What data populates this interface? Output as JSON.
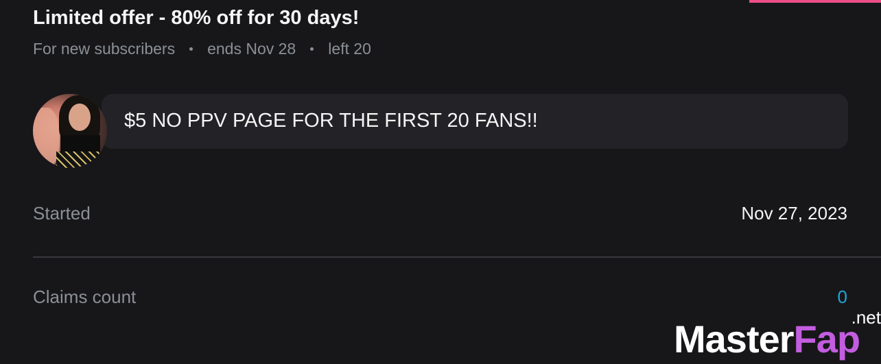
{
  "offer": {
    "title": "Limited offer - 80% off for 30 days!",
    "audience": "For new subscribers",
    "ends": "ends Nov 28",
    "remaining": "left 20"
  },
  "message": {
    "text": "$5 NO PPV PAGE FOR THE FIRST 20 FANS!!"
  },
  "details": {
    "started_label": "Started",
    "started_value": "Nov 27, 2023",
    "claims_label": "Claims count",
    "claims_value": "0"
  },
  "watermark": {
    "main": "Master",
    "accent": "Fap",
    "suffix": ".net"
  },
  "colors": {
    "background": "#17171a",
    "accent_pink": "#ec4f86",
    "accent_blue": "#1fa6d6",
    "muted_text": "#8c9095",
    "bubble": "#232327"
  }
}
